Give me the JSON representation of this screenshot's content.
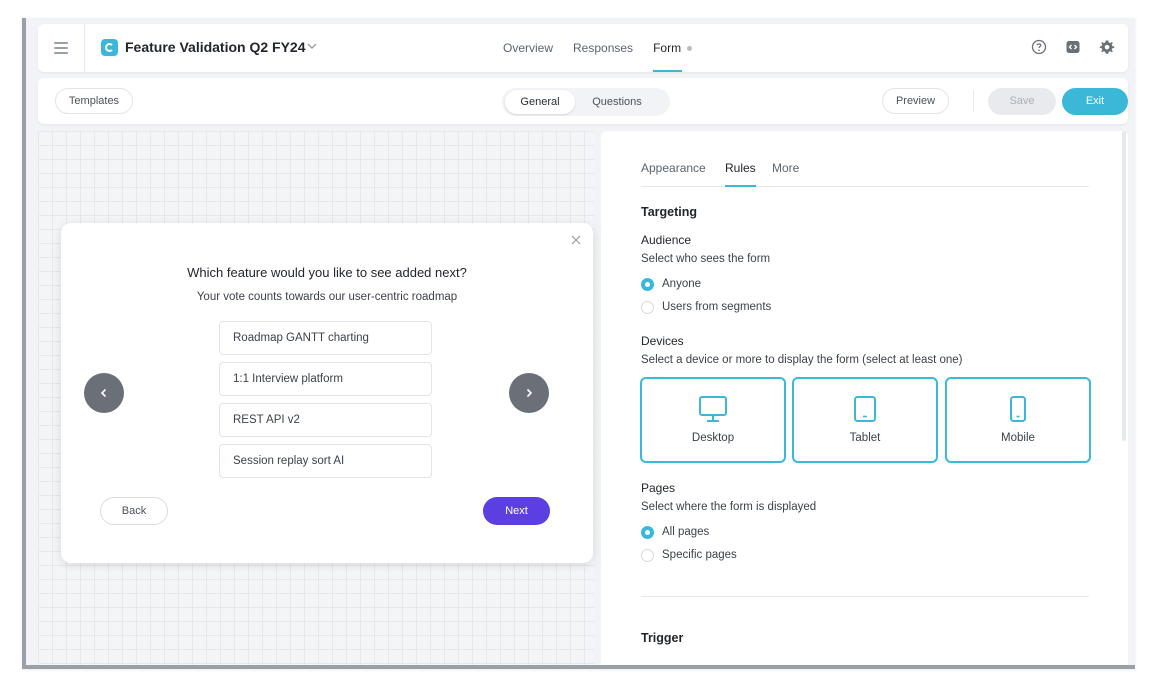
{
  "header": {
    "form_title": "Feature Validation Q2 FY24",
    "tabs": [
      {
        "label": "Overview"
      },
      {
        "label": "Responses"
      },
      {
        "label": "Form"
      }
    ],
    "active_tab": "Form"
  },
  "toolbar": {
    "templates_label": "Templates",
    "segments": [
      {
        "label": "General"
      },
      {
        "label": "Questions"
      }
    ],
    "active_segment": "General",
    "preview_label": "Preview",
    "save_label": "Save",
    "exit_label": "Exit"
  },
  "preview": {
    "question": "Which feature would you like to see added next?",
    "subtitle": "Your vote counts towards our user-centric roadmap",
    "options": [
      {
        "label": "Roadmap GANTT charting"
      },
      {
        "label": "1:1 Interview platform"
      },
      {
        "label": "REST API v2"
      },
      {
        "label": "Session replay sort AI"
      }
    ],
    "back_label": "Back",
    "next_label": "Next"
  },
  "settings": {
    "tabs": [
      {
        "label": "Appearance"
      },
      {
        "label": "Rules"
      },
      {
        "label": "More"
      }
    ],
    "active_tab": "Rules",
    "targeting": {
      "title": "Targeting",
      "audience": {
        "label": "Audience",
        "description": "Select who sees the form",
        "options": [
          {
            "label": "Anyone",
            "selected": true
          },
          {
            "label": "Users from segments",
            "selected": false
          }
        ]
      },
      "devices": {
        "label": "Devices",
        "description": "Select a device or more to display the form (select at least one)",
        "items": [
          {
            "label": "Desktop",
            "icon": "desktop-icon",
            "selected": true
          },
          {
            "label": "Tablet",
            "icon": "tablet-icon",
            "selected": true
          },
          {
            "label": "Mobile",
            "icon": "mobile-icon",
            "selected": true
          }
        ]
      },
      "pages": {
        "label": "Pages",
        "description": "Select where the form is displayed",
        "options": [
          {
            "label": "All pages",
            "selected": true
          },
          {
            "label": "Specific pages",
            "selected": false
          }
        ]
      }
    },
    "trigger": {
      "title": "Trigger"
    }
  },
  "colors": {
    "accent": "#3bb8d8",
    "next_button": "#5b3fe0",
    "nav_circle": "#6b7078"
  }
}
